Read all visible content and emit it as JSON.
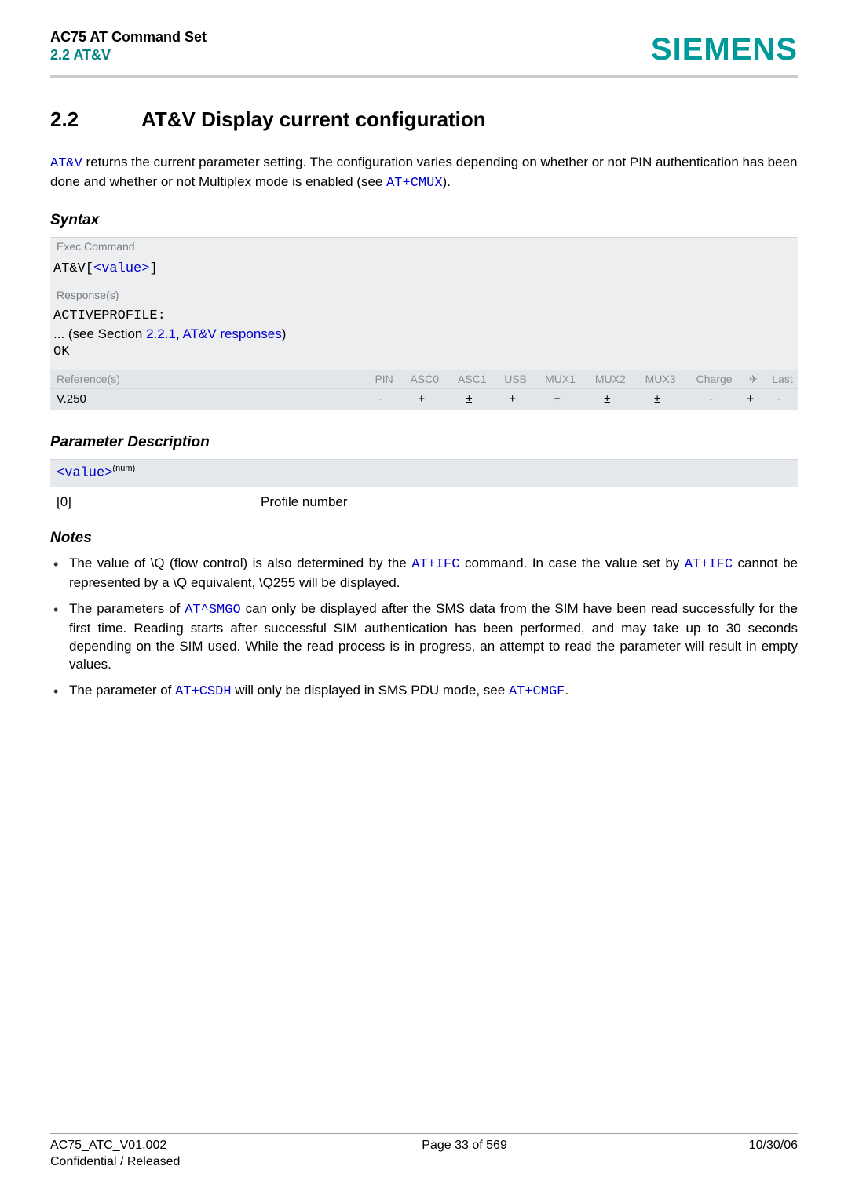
{
  "header": {
    "doc_title": "AC75 AT Command Set",
    "section_ref": "2.2 AT&V",
    "logo": "SIEMENS"
  },
  "section": {
    "number": "2.2",
    "title": "AT&V   Display current configuration",
    "intro_pre": " returns the current parameter setting. The configuration varies depending on whether or not PIN authentication has been done and whether or not Multiplex mode is enabled (see ",
    "cmd1": "AT&V",
    "cmd2": "AT+CMUX",
    "intro_post": ")."
  },
  "syntax": {
    "heading": "Syntax",
    "exec_label": "Exec Command",
    "exec_cmd_pre": "AT&V[",
    "exec_cmd_link": "<value>",
    "exec_cmd_post": "]",
    "response_label": "Response(s)",
    "resp_line1": "ACTIVEPROFILE:",
    "resp_line2_pre": "... (see Section ",
    "resp_line2_link1": "2.2.1",
    "resp_line2_mid": ", ",
    "resp_line2_link2": "AT&V responses",
    "resp_line2_post": ")",
    "resp_line3": "OK",
    "ref_label": "Reference(s)",
    "ref_cols": [
      "PIN",
      "ASC0",
      "ASC1",
      "USB",
      "MUX1",
      "MUX2",
      "MUX3",
      "Charge",
      "",
      "Last"
    ],
    "plane": "✈",
    "ref_name": "V.250",
    "ref_vals": [
      "-",
      "+",
      "±",
      "+",
      "+",
      "±",
      "±",
      "-",
      "+",
      "-"
    ]
  },
  "params": {
    "heading": "Parameter Description",
    "name": "<value>",
    "sup": "(num)",
    "key": "[0]",
    "desc": "Profile number"
  },
  "notes": {
    "heading": "Notes",
    "n1_a": "The value of \\Q (flow control) is also determined by the ",
    "n1_cmd1": "AT+IFC",
    "n1_b": " command. In case the value set by ",
    "n1_cmd2": "AT+IFC",
    "n1_c": " cannot be represented by a \\Q equivalent, \\Q255 will be displayed.",
    "n2_a": "The parameters of ",
    "n2_cmd": "AT^SMGO",
    "n2_b": " can only be displayed after the SMS data from the SIM have been read successfully for the first time. Reading starts after successful SIM authentication has been performed, and may take up to 30 seconds depending on the SIM used. While the read process is in progress, an attempt to read the parameter will result in empty values.",
    "n3_a": "The parameter of ",
    "n3_cmd1": "AT+CSDH",
    "n3_b": " will only be displayed in SMS PDU mode, see ",
    "n3_cmd2": "AT+CMGF",
    "n3_c": "."
  },
  "footer": {
    "left1": "AC75_ATC_V01.002",
    "left2": "Confidential / Released",
    "center": "Page 33 of 569",
    "right": "10/30/06"
  }
}
